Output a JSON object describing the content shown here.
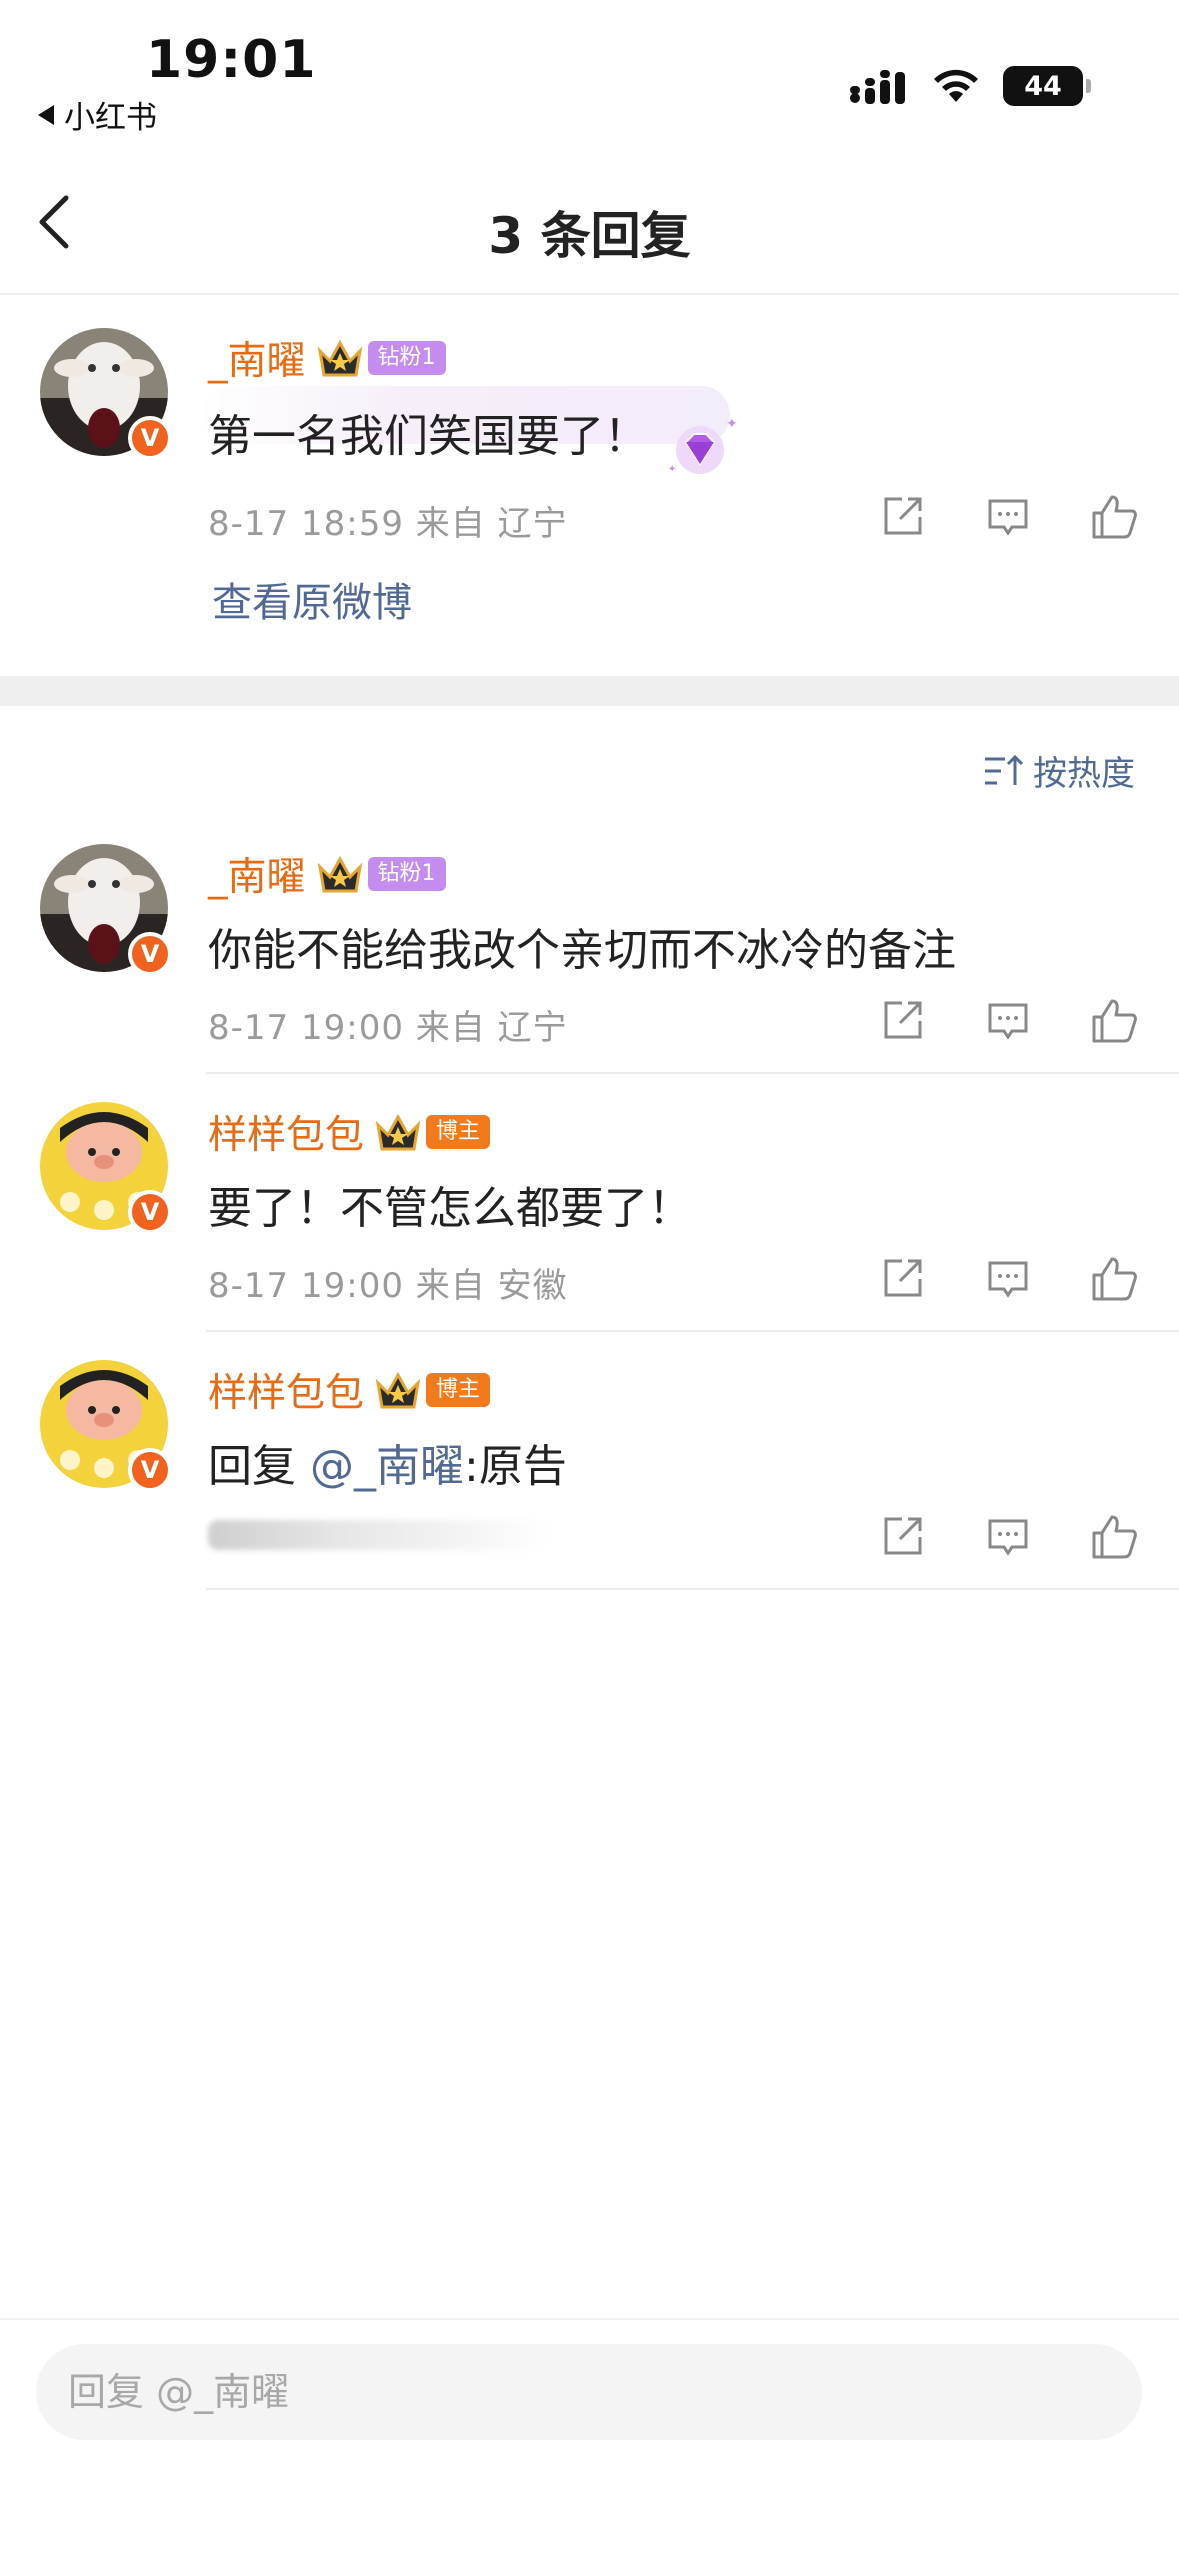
{
  "status_bar": {
    "time": "19:01",
    "back_app": "小红书",
    "battery": "44"
  },
  "nav": {
    "title": "3 条回复"
  },
  "original_comment": {
    "username": "_南曜",
    "fan_badge": "钻粉1",
    "text": "第一名我们笑国要了！",
    "meta": "8-17 18:59  来自 辽宁",
    "view_original": "查看原微博"
  },
  "sort": {
    "label": "按热度"
  },
  "replies": [
    {
      "username": "_南曜",
      "fan_badge": "钻粉1",
      "badge_color": "#c58cf0",
      "text": "你能不能给我改个亲切而不冰冷的备注",
      "meta": "8-17 19:00  来自 辽宁"
    },
    {
      "username": "样样包包",
      "fan_badge": "博主",
      "badge_color": "#f27a1a",
      "text": "要了！不管怎么都要了！",
      "meta": "8-17 19:00  来自 安徽"
    },
    {
      "username": "样样包包",
      "fan_badge": "博主",
      "badge_color": "#f27a1a",
      "text_prefix": "回复 ",
      "mention": "@_南曜",
      "text_suffix": ":原告"
    }
  ],
  "reply_bar": {
    "placeholder": "回复 @_南曜"
  },
  "icons": [
    "chevron-left-icon",
    "signal-icon",
    "wifi-icon",
    "battery-icon",
    "crown-icon",
    "verified-icon",
    "share-icon",
    "comment-icon",
    "like-icon",
    "sort-icon",
    "diamond-icon"
  ]
}
